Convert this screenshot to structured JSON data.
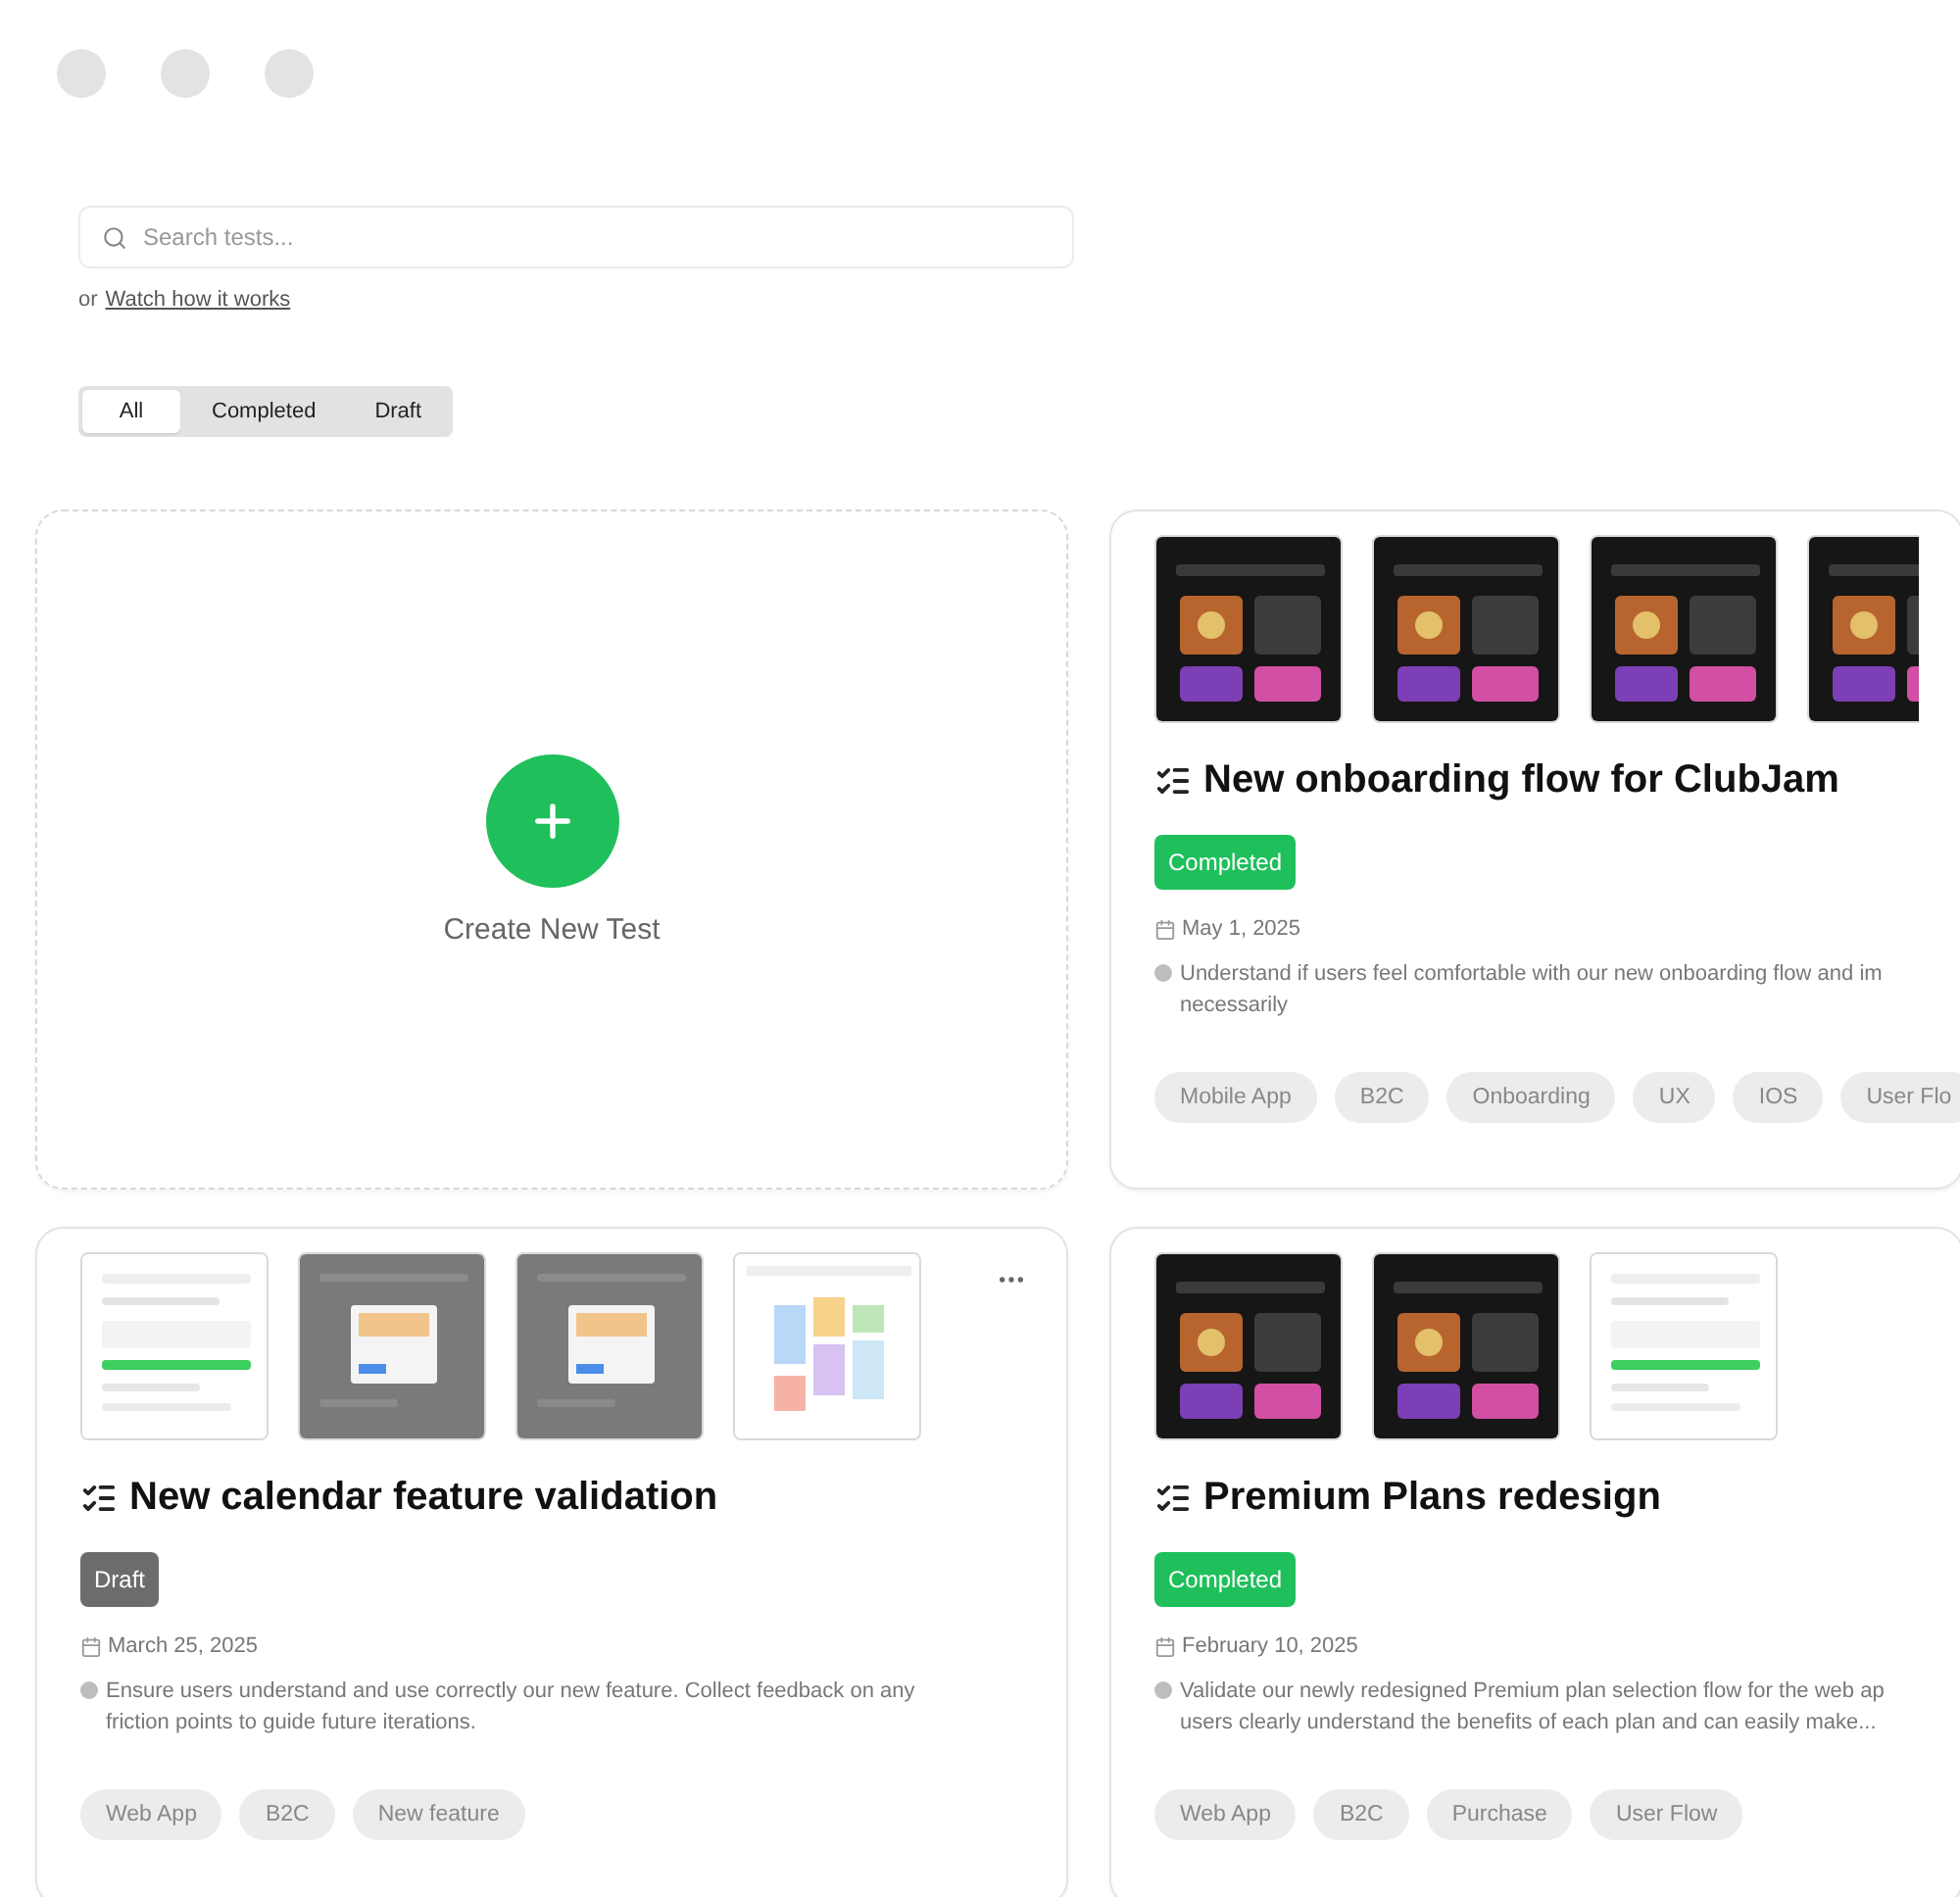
{
  "search": {
    "placeholder": "Search tests..."
  },
  "help": {
    "prefix": "or",
    "link": "Watch how it works"
  },
  "filters": [
    {
      "label": "All",
      "selected": true
    },
    {
      "label": "Completed",
      "selected": false
    },
    {
      "label": "Draft",
      "selected": false
    }
  ],
  "create_card": {
    "label": "Create New Test"
  },
  "tests": [
    {
      "title": "New onboarding flow for ClubJam",
      "status": {
        "label": "Completed",
        "kind": "completed"
      },
      "date": "May 1, 2025",
      "description_lines": [
        "Understand if users feel comfortable with our new onboarding flow and im",
        "necessarily"
      ],
      "tags": [
        "Mobile App",
        "B2C",
        "Onboarding",
        "UX",
        "IOS",
        "User Flo"
      ],
      "has_menu": false,
      "thumbnails": [
        {
          "kind": "dark"
        },
        {
          "kind": "dark"
        },
        {
          "kind": "dark"
        },
        {
          "kind": "dark"
        }
      ]
    },
    {
      "title": "New calendar feature validation",
      "status": {
        "label": "Draft",
        "kind": "draft"
      },
      "date": "March 25, 2025",
      "description_lines": [
        "Ensure users understand and use correctly our new feature. Collect feedback on any",
        "friction points to guide future iterations."
      ],
      "tags": [
        "Web App",
        "B2C",
        "New feature"
      ],
      "has_menu": true,
      "thumbnails": [
        {
          "kind": "light"
        },
        {
          "kind": "grey"
        },
        {
          "kind": "grey"
        },
        {
          "kind": "calendar"
        }
      ]
    },
    {
      "title": "Premium Plans redesign",
      "status": {
        "label": "Completed",
        "kind": "completed"
      },
      "date": "February 10, 2025",
      "description_lines": [
        "Validate our newly redesigned Premium plan selection flow for the web ap",
        "users clearly understand the benefits of each plan and can easily make..."
      ],
      "tags": [
        "Web App",
        "B2C",
        "Purchase",
        "User Flow"
      ],
      "has_menu": false,
      "thumbnails": [
        {
          "kind": "dark"
        },
        {
          "kind": "dark"
        },
        {
          "kind": "light"
        }
      ]
    }
  ]
}
